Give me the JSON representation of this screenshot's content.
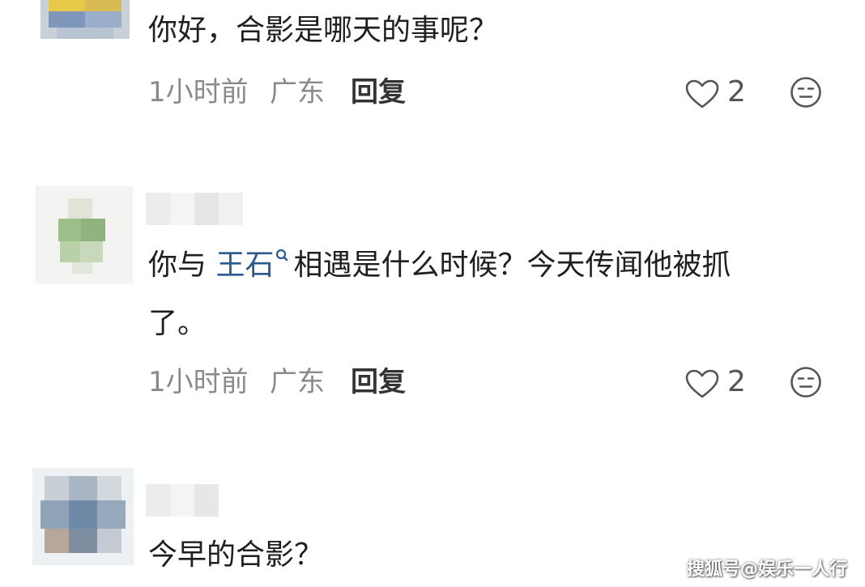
{
  "comments": [
    {
      "text": "你好，合影是哪天的事呢？",
      "time": "1小时前",
      "location": "广东",
      "reply_label": "回复",
      "like_count": "2"
    },
    {
      "text_before": "你与 ",
      "mention": "王石",
      "text_after": "相遇是什么时候？今天传闻他被抓",
      "text_line2": "了。",
      "time": "1小时前",
      "location": "广东",
      "reply_label": "回复",
      "like_count": "2"
    },
    {
      "text": "今早的合影？"
    }
  ],
  "watermark": "搜狐号@娱乐一人行",
  "icons": {
    "like": "heart-outline-icon",
    "react": "neutral-face-icon",
    "mention": "search-icon"
  },
  "colors": {
    "mention": "#2a5a8f",
    "meta": "#8a8a8a",
    "text": "#1f1f1f"
  }
}
